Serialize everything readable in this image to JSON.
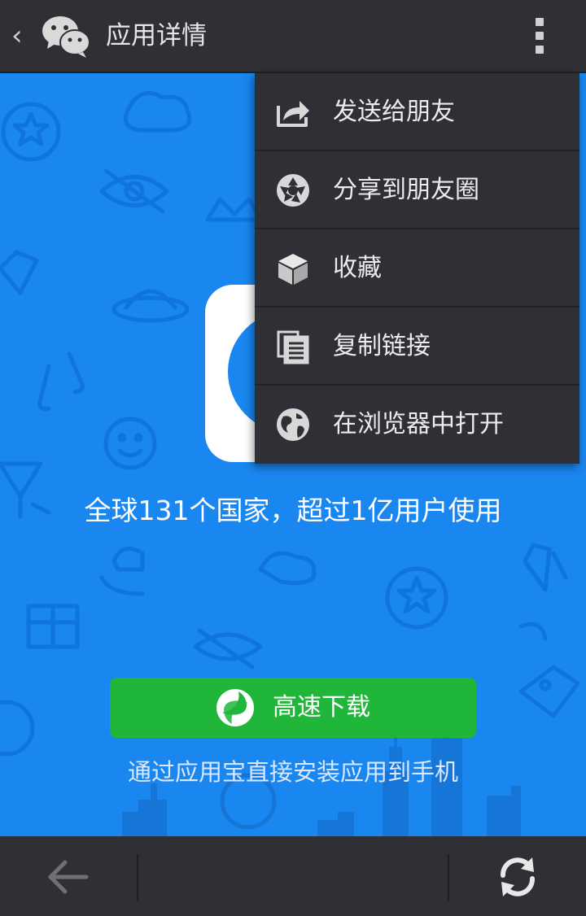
{
  "header": {
    "title": "应用详情",
    "back_icon": "chevron-left-icon",
    "logo_icon": "wechat-logo-icon",
    "more_icon": "more-vertical-icon"
  },
  "menu": {
    "items": [
      {
        "label": "发送给朋友",
        "icon": "share-forward-icon"
      },
      {
        "label": "分享到朋友圈",
        "icon": "moments-shutter-icon"
      },
      {
        "label": "收藏",
        "icon": "favorite-cube-icon"
      },
      {
        "label": "复制链接",
        "icon": "copy-document-icon"
      },
      {
        "label": "在浏览器中打开",
        "icon": "globe-icon"
      }
    ]
  },
  "main": {
    "headline": "全球131个国家，超过1亿用户使用",
    "download_label": "高速下载",
    "subtext": "通过应用宝直接安装应用到手机"
  },
  "bottom": {
    "back_icon": "arrow-left-icon",
    "refresh_icon": "refresh-icon"
  },
  "colors": {
    "background": "#1a86f0",
    "bar": "#2e3035",
    "download_button": "#1fb63a",
    "menu_text": "#ececec"
  }
}
